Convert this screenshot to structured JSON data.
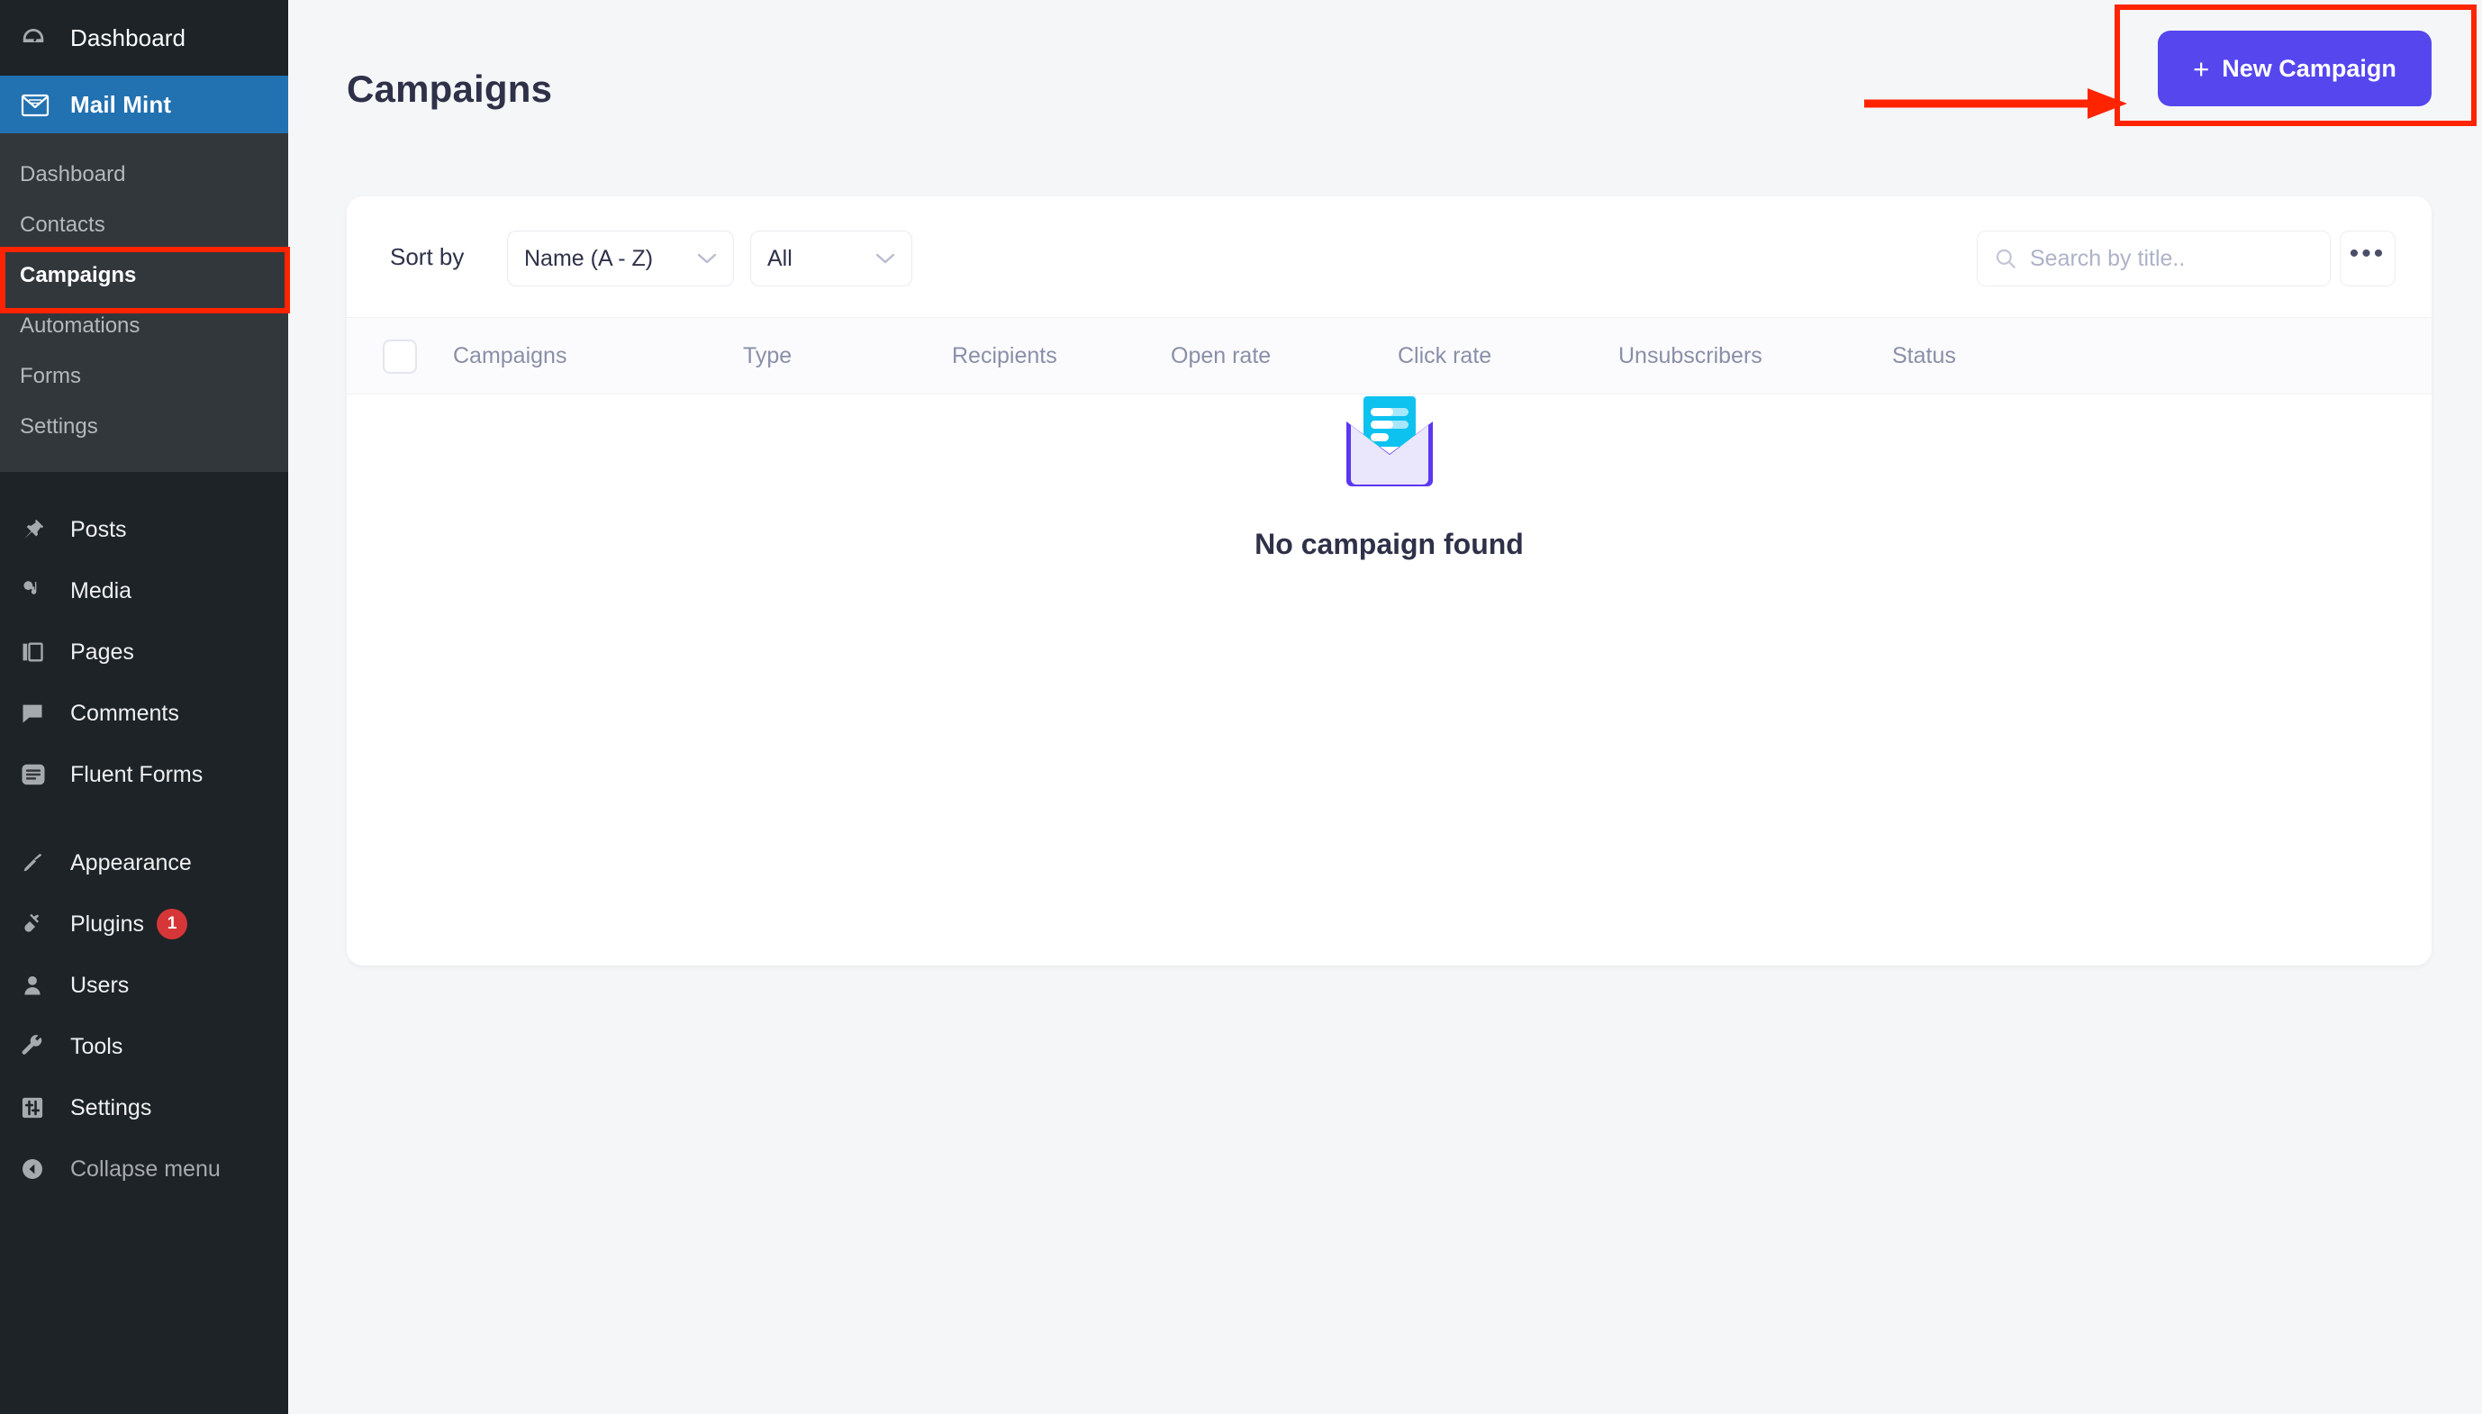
{
  "sidebar": {
    "top_item": {
      "label": "Dashboard",
      "icon": "dashboard-icon"
    },
    "plugin_menu": {
      "label": "Mail Mint",
      "icon": "envelope-icon",
      "submenu": [
        {
          "label": "Dashboard",
          "current": false
        },
        {
          "label": "Contacts",
          "current": false
        },
        {
          "label": "Campaigns",
          "current": true
        },
        {
          "label": "Automations",
          "current": false
        },
        {
          "label": "Forms",
          "current": false
        },
        {
          "label": "Settings",
          "current": false
        }
      ]
    },
    "group_one": [
      {
        "label": "Posts",
        "icon": "pin-icon"
      },
      {
        "label": "Media",
        "icon": "media-icon"
      },
      {
        "label": "Pages",
        "icon": "pages-icon"
      },
      {
        "label": "Comments",
        "icon": "comment-icon"
      },
      {
        "label": "Fluent Forms",
        "icon": "fluent-forms-icon"
      }
    ],
    "group_two": [
      {
        "label": "Appearance",
        "icon": "brush-icon",
        "badge": ""
      },
      {
        "label": "Plugins",
        "icon": "plug-icon",
        "badge": "1"
      },
      {
        "label": "Users",
        "icon": "user-icon",
        "badge": ""
      },
      {
        "label": "Tools",
        "icon": "wrench-icon",
        "badge": ""
      },
      {
        "label": "Settings",
        "icon": "sliders-icon",
        "badge": ""
      }
    ],
    "collapse": {
      "label": "Collapse menu",
      "icon": "collapse-arrow-icon"
    }
  },
  "header": {
    "title": "Campaigns",
    "new_campaign_label": "New Campaign",
    "new_campaign_plus": "+"
  },
  "toolbar": {
    "sort_by_label": "Sort by",
    "sort_value": "Name (A - Z)",
    "filter_value": "All",
    "search_placeholder": "Search by title..",
    "search_value": "",
    "more_label": "•••"
  },
  "table": {
    "columns": [
      "Campaigns",
      "Type",
      "Recipients",
      "Open rate",
      "Click rate",
      "Unsubscribers",
      "Status"
    ],
    "rows": [],
    "empty_message": "No campaign found"
  },
  "colors": {
    "accent": "#5546ee",
    "sidebar_bg": "#1d2327",
    "submenu_bg": "#32373c",
    "highlight_blue": "#2271b1",
    "annotation_red": "#ff2400",
    "badge_red": "#d63638",
    "page_bg": "#f5f6f8",
    "text_dark": "#2e3148",
    "text_muted": "#8a8fa8"
  }
}
